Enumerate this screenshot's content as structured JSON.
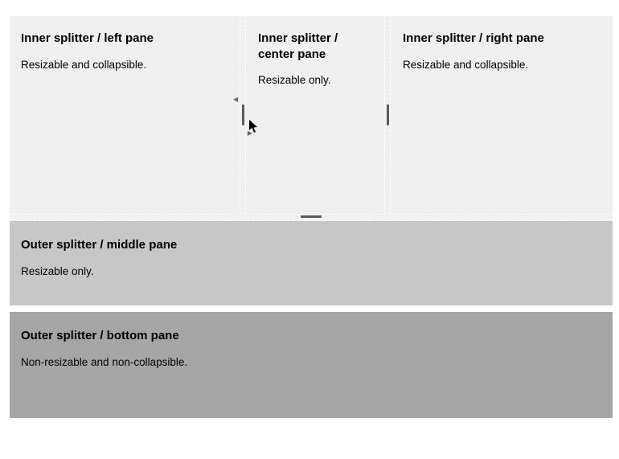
{
  "inner": {
    "left": {
      "title": "Inner splitter / left pane",
      "desc": "Resizable and collapsible."
    },
    "center": {
      "title": "Inner splitter / center pane",
      "desc": "Resizable only."
    },
    "right": {
      "title": "Inner splitter / right pane",
      "desc": "Resizable and collapsible."
    }
  },
  "outer": {
    "middle": {
      "title": "Outer splitter / middle pane",
      "desc": "Resizable only."
    },
    "bottom": {
      "title": "Outer splitter / bottom pane",
      "desc": "Non-resizable and non-collapsible."
    }
  }
}
